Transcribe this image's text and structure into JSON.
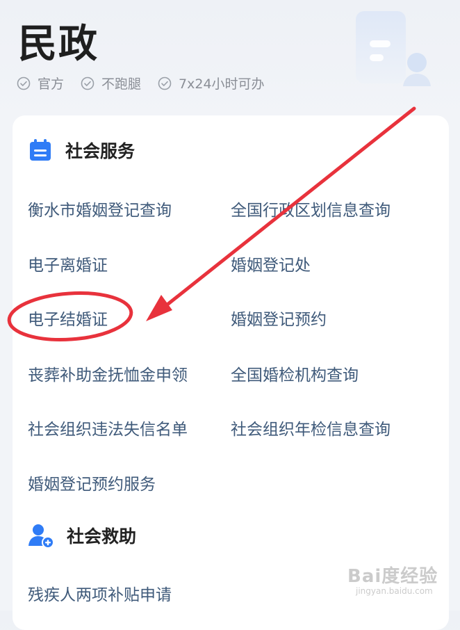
{
  "header": {
    "title": "民政",
    "tags": [
      "官方",
      "不跑腿",
      "7x24小时可办"
    ]
  },
  "sections": [
    {
      "title": "社会服务",
      "icon": "calendar-icon",
      "items": [
        "衡水市婚姻登记查询",
        "全国行政区划信息查询",
        "电子离婚证",
        "婚姻登记处",
        "电子结婚证",
        "婚姻登记预约",
        "丧葬补助金抚恤金申领",
        "全国婚检机构查询",
        "社会组织违法失信名单",
        "社会组织年检信息查询",
        "婚姻登记预约服务"
      ]
    },
    {
      "title": "社会救助",
      "icon": "user-plus-icon",
      "items": [
        "残疾人两项补贴申请"
      ]
    }
  ],
  "watermark": {
    "main": "Bai度经验",
    "sub": "jingyan.baidu.com"
  },
  "colors": {
    "accent": "#2f7cf6",
    "link_text": "#3f5a7a",
    "annotation_red": "#e8323c"
  }
}
